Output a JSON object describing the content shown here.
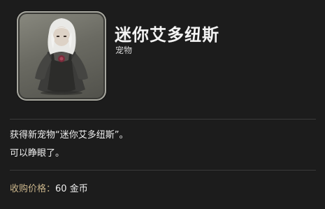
{
  "item": {
    "name": "迷你艾多纽斯",
    "category": "宠物",
    "icon": "minion-portrait-icon"
  },
  "description": {
    "line1": "获得新宠物“迷你艾多纽斯”。",
    "line2": "可以睁眼了。"
  },
  "price": {
    "label": "收购价格：",
    "value": "60 金币"
  },
  "colors": {
    "background": "#1c1c1c",
    "price_label": "#c9b48a",
    "text": "#eeeeee"
  }
}
